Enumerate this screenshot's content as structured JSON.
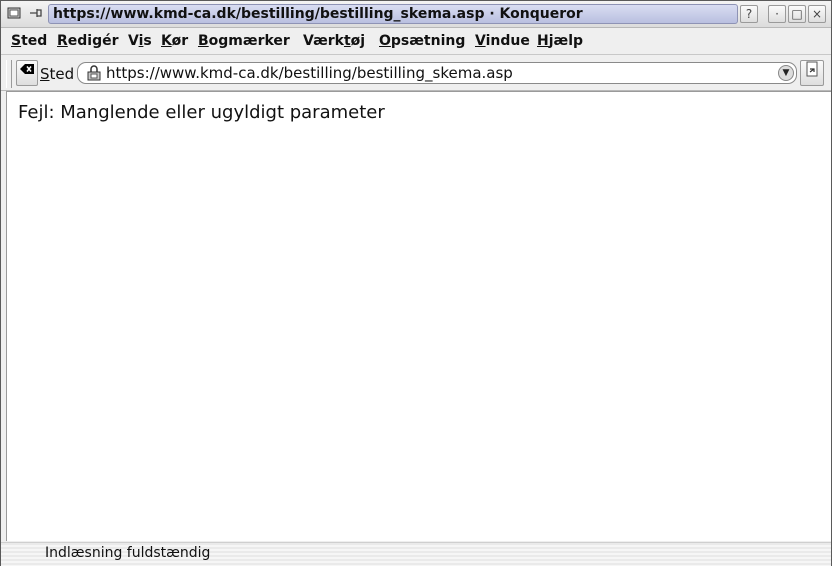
{
  "window": {
    "title": "https://www.kmd-ca.dk/bestilling/bestilling_skema.asp · Konqueror",
    "buttons": {
      "help": "?",
      "minimize": "·",
      "maximize": "□",
      "close": "×"
    }
  },
  "menu": [
    {
      "label_u": "S",
      "label_rest": "ted",
      "name": "menu-sted"
    },
    {
      "label_u": "R",
      "label_rest": "edigér",
      "name": "menu-rediger"
    },
    {
      "label_pre": "V",
      "label_u": "i",
      "label_rest": "s",
      "name": "menu-vis"
    },
    {
      "label_u": "K",
      "label_rest": "ør",
      "name": "menu-kor"
    },
    {
      "label_u": "B",
      "label_rest": "ogmærker",
      "name": "menu-bogmaerker"
    },
    {
      "label_pre": "Værk",
      "label_u": "t",
      "label_rest": "øj",
      "name": "menu-vaerktoj"
    },
    {
      "label_u": "O",
      "label_rest": "psætning",
      "name": "menu-opsaetning"
    },
    {
      "label_u": "V",
      "label_rest": "indue",
      "name": "menu-vindue"
    },
    {
      "label_u": "H",
      "label_rest": "jælp",
      "name": "menu-hjaelp"
    }
  ],
  "location": {
    "label_u": "S",
    "label_rest": "ted",
    "url": "https://www.kmd-ca.dk/bestilling/bestilling_skema.asp"
  },
  "content": {
    "message": "Fejl: Manglende eller ugyldigt parameter"
  },
  "status": {
    "text": "Indlæsning fuldstændig"
  },
  "icons": {
    "app": "konqueror-icon",
    "pin": "pin-icon",
    "clear": "clear-location-icon",
    "lock": "lock-icon",
    "dropdown": "chevron-down-icon",
    "go": "go-icon"
  }
}
